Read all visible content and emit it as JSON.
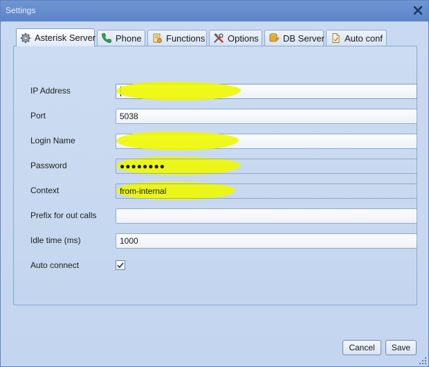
{
  "window": {
    "title": "Settings"
  },
  "tabs": [
    {
      "label": "Asterisk Server",
      "icon": "gear-icon",
      "active": true
    },
    {
      "label": "Phone",
      "icon": "phone-icon",
      "active": false
    },
    {
      "label": "Functions",
      "icon": "functions-icon",
      "active": false
    },
    {
      "label": "Options",
      "icon": "tools-icon",
      "active": false
    },
    {
      "label": "DB Server",
      "icon": "database-icon",
      "active": false
    },
    {
      "label": "Auto conf",
      "icon": "autoconf-icon",
      "active": false
    }
  ],
  "form": {
    "ip_address": {
      "label": "IP Address",
      "value": ""
    },
    "port": {
      "label": "Port",
      "value": "5038"
    },
    "login_name": {
      "label": "Login Name",
      "value": ""
    },
    "password": {
      "label": "Password",
      "value": "●●●●●●●●"
    },
    "context": {
      "label": "Context",
      "value": "from-internal"
    },
    "prefix": {
      "label": "Prefix for out calls",
      "value": ""
    },
    "idle_time": {
      "label": "Idle time (ms)",
      "value": "1000"
    },
    "auto_connect": {
      "label": "Auto connect",
      "checked": true
    }
  },
  "buttons": {
    "cancel": "Cancel",
    "save": "Save"
  },
  "colors": {
    "titlebar": "#5b84c8",
    "panel": "#c4d6ef",
    "redaction_highlight": "#eef800"
  }
}
